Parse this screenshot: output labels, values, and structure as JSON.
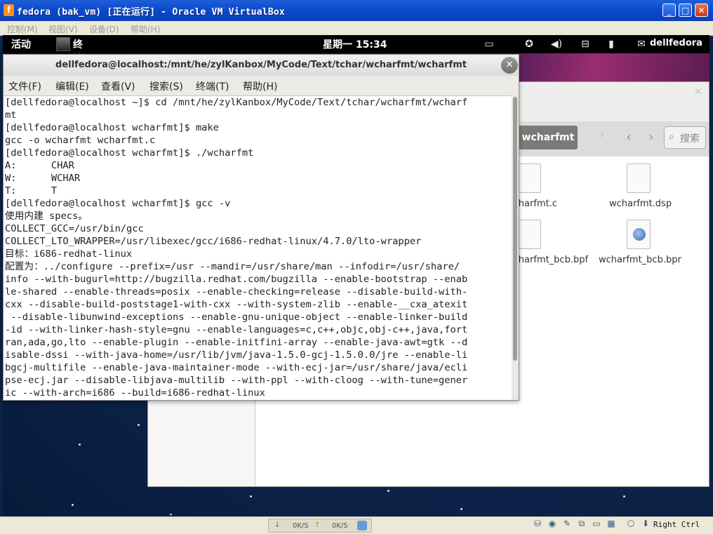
{
  "vbox": {
    "title": "fedora (bak_vm) [正在运行] - Oracle VM VirtualBox",
    "menu": [
      "控制(M)",
      "视图(V)",
      "设备(D)",
      "帮助(H)"
    ],
    "host_key": "Right Ctrl",
    "net_down": "0K/S",
    "net_up": "0K/S"
  },
  "gnome": {
    "activities": "活动",
    "app_name": "终端",
    "clock": "星期一 15:34",
    "user": "dellfedora",
    "tray_icons": [
      "display-icon",
      "accessibility-icon",
      "volume-icon",
      "network-icon",
      "battery-icon",
      "chat-icon"
    ]
  },
  "terminal": {
    "title": "dellfedora@localhost:/mnt/he/zylKanbox/MyCode/Text/tchar/wcharfmt/wcharfmt",
    "menu": [
      "文件(F)",
      "编辑(E)",
      "查看(V)",
      "搜索(S)",
      "终端(T)",
      "帮助(H)"
    ],
    "lines": [
      "[dellfedora@localhost ~]$ cd /mnt/he/zylKanbox/MyCode/Text/tchar/wcharfmt/wcharf",
      "mt",
      "[dellfedora@localhost wcharfmt]$ make",
      "gcc -o wcharfmt wcharfmt.c",
      "[dellfedora@localhost wcharfmt]$ ./wcharfmt",
      "A:      CHAR",
      "W:      WCHAR",
      "T:      T",
      "[dellfedora@localhost wcharfmt]$ gcc -v",
      "使用内建 specs。",
      "COLLECT_GCC=/usr/bin/gcc",
      "COLLECT_LTO_WRAPPER=/usr/libexec/gcc/i686-redhat-linux/4.7.0/lto-wrapper",
      "目标：i686-redhat-linux",
      "配置为：../configure --prefix=/usr --mandir=/usr/share/man --infodir=/usr/share/",
      "info --with-bugurl=http://bugzilla.redhat.com/bugzilla --enable-bootstrap --enab",
      "le-shared --enable-threads=posix --enable-checking=release --disable-build-with-",
      "cxx --disable-build-poststage1-with-cxx --with-system-zlib --enable-__cxa_atexit",
      " --disable-libunwind-exceptions --enable-gnu-unique-object --enable-linker-build",
      "-id --with-linker-hash-style=gnu --enable-languages=c,c++,objc,obj-c++,java,fort",
      "ran,ada,go,lto --enable-plugin --enable-initfini-array --enable-java-awt=gtk --d",
      "isable-dssi --with-java-home=/usr/lib/jvm/java-1.5.0-gcj-1.5.0.0/jre --enable-li",
      "bgcj-multifile --enable-java-maintainer-mode --with-ecj-jar=/usr/share/java/ecli",
      "pse-ecj.jar --disable-libjava-multilib --with-ppl --with-cloog --with-tune=gener",
      "ic --with-arch=i686 --build=i686-redhat-linux"
    ]
  },
  "nautilus": {
    "path_button": "wcharfmt",
    "search_label": "搜索",
    "files": [
      "wcharfmt.c",
      "wcharfmt.dsp",
      "wcharfmt_bcb.bpf",
      "wcharfmt_bcb.bpr"
    ]
  }
}
